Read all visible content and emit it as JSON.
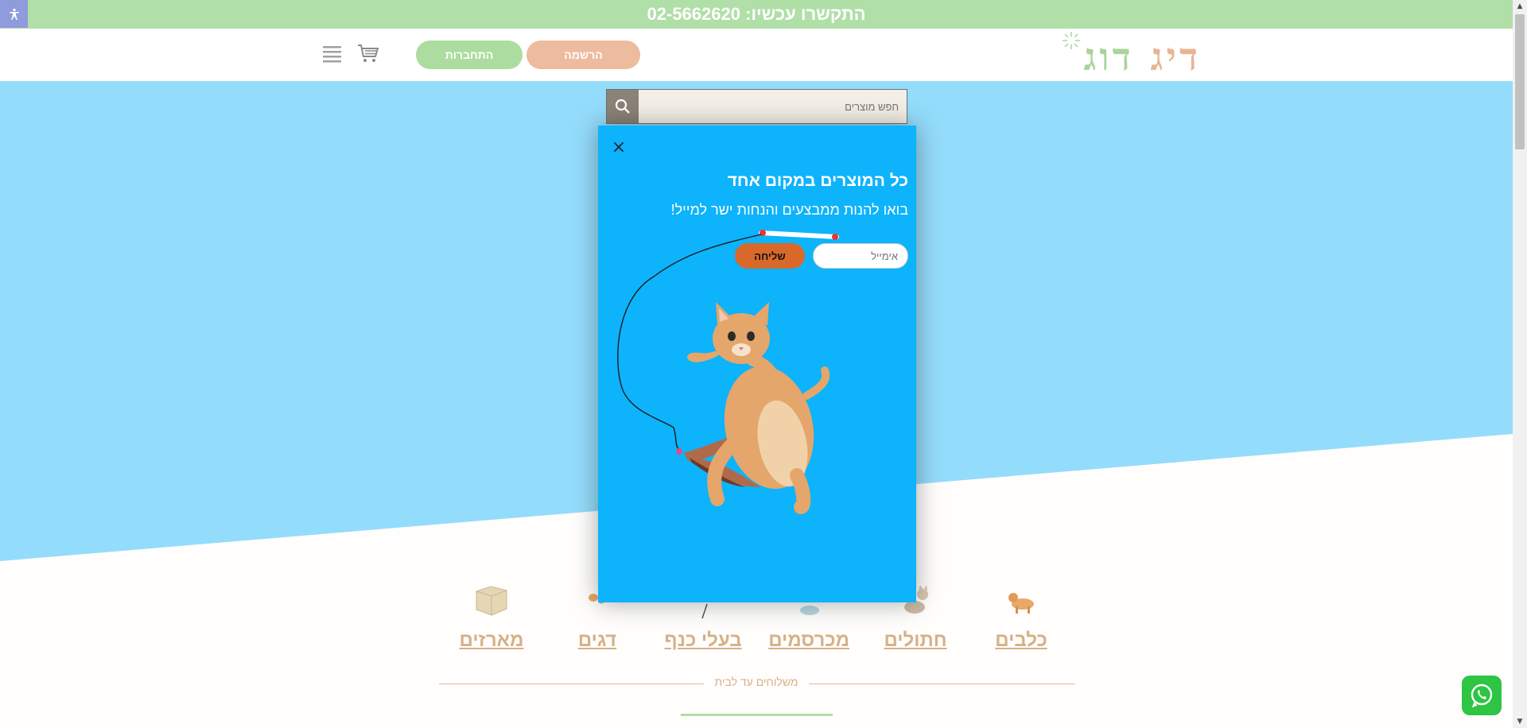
{
  "topbar": {
    "phone_text": "התקשרו עכשיו: 02-5662620"
  },
  "header": {
    "logo_part1": "דיג",
    "logo_part2": "דוג",
    "register_label": "הרשמה",
    "login_label": "התחברות"
  },
  "search": {
    "placeholder": "חפש מוצרים"
  },
  "modal": {
    "title": "כל המוצרים במקום אחד",
    "subtitle": "בואו להנות ממבצעים והנחות ישר למייל!",
    "email_placeholder": "אימייל",
    "send_label": "שליחה",
    "close_symbol": "×"
  },
  "categories": [
    {
      "label": "כלבים"
    },
    {
      "label": "חתולים"
    },
    {
      "label": "מכרסמים"
    },
    {
      "label": "בעלי כנף"
    },
    {
      "label": "דגים"
    },
    {
      "label": "מארזים"
    }
  ],
  "footer_divider": {
    "text": "משלוחים עד לבית"
  },
  "colors": {
    "topbar_green": "#b0dfa8",
    "hero_blue": "#94dcfb",
    "modal_blue": "#0db3fb",
    "accent_peach": "#edbb9e",
    "send_orange": "#d9692b",
    "category_tan": "#d6b088"
  },
  "icons": [
    "accessibility-icon",
    "cart-icon",
    "menu-icon",
    "search-icon",
    "close-icon",
    "whatsapp-icon"
  ]
}
